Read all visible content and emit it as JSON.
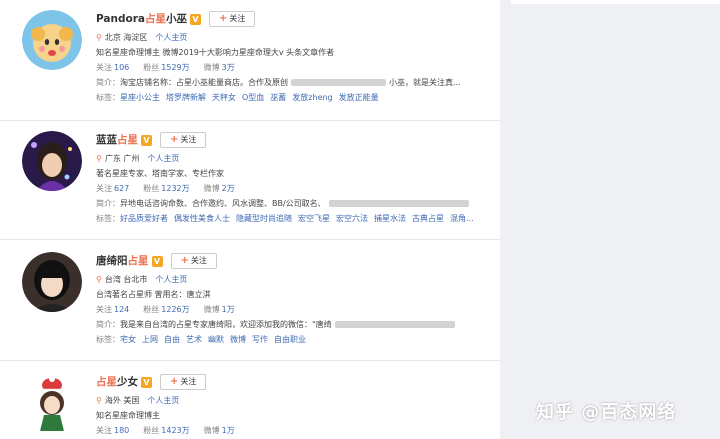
{
  "follow_label": "关注",
  "follow_plus": "+",
  "location_icon": "pin-icon",
  "verified_icon": "V",
  "homepage_label": "个人主页",
  "stats_labels": {
    "follow": "关注",
    "fans": "粉丝",
    "weibo": "微博"
  },
  "bio_label": "简介：",
  "tags_label": "标签：",
  "colors": {
    "accent": "#eb7350",
    "link": "#3f6ab4",
    "verified": "#f5a623"
  },
  "users": [
    {
      "name_main": "Pandora",
      "name_highlight": "占星",
      "name_suffix": "小巫",
      "location": "北京 海淀区",
      "desc": "知名星座命理博主 微博2019十大影响力星座命理大v 头条文章作者",
      "follow": "106",
      "fans": "1529万",
      "weibo": "3万",
      "bio_start": "淘宝店铺名称：占星小巫能量商店。合作及原创",
      "bio_end": "小巫，就是关注真...",
      "tags": [
        "星座小公主",
        "塔罗牌新解",
        "天秤女",
        "O型血",
        "巫蓄",
        "发放zheng",
        "发放正能量"
      ]
    },
    {
      "name_main": "蓝蓝",
      "name_highlight": "占星",
      "name_suffix": "",
      "location": "广东 广州",
      "desc": "著名星座专家、塔南学家、专栏作家",
      "follow": "627",
      "fans": "1232万",
      "weibo": "2万",
      "bio_start": "异地电话咨询命数、合作邀约、风水调整、BB/公司取名、",
      "bio_end": "",
      "tags": [
        "好品质爱好者",
        "偶发性美食人士",
        "隐藏型时尚追随",
        "宏空飞星",
        "宏空六法",
        "捕星水法",
        "古典占星",
        "混角..."
      ]
    },
    {
      "name_main": "唐绮阳",
      "name_highlight": "占星",
      "name_suffix": "",
      "location": "台湾 台北市",
      "desc": "台湾著名占星师 曾用名：唐立淇",
      "follow": "124",
      "fans": "1226万",
      "weibo": "1万",
      "bio_start": "我是来自台湾的占星专家唐绮阳，欢迎添加我的微信：\"唐绮",
      "bio_end": "",
      "tags": [
        "宅女",
        "上网",
        "自由",
        "艺术",
        "幽默",
        "微博",
        "写作",
        "自由职业"
      ]
    },
    {
      "name_main": "",
      "name_highlight": "占星",
      "name_suffix": "少女",
      "location": "海外 美国",
      "desc": "知名星座命理博主",
      "follow": "180",
      "fans": "1423万",
      "weibo": "1万",
      "bio_start": "",
      "bio_end": "",
      "tags": []
    }
  ],
  "watermark": "知乎 @百态网络"
}
